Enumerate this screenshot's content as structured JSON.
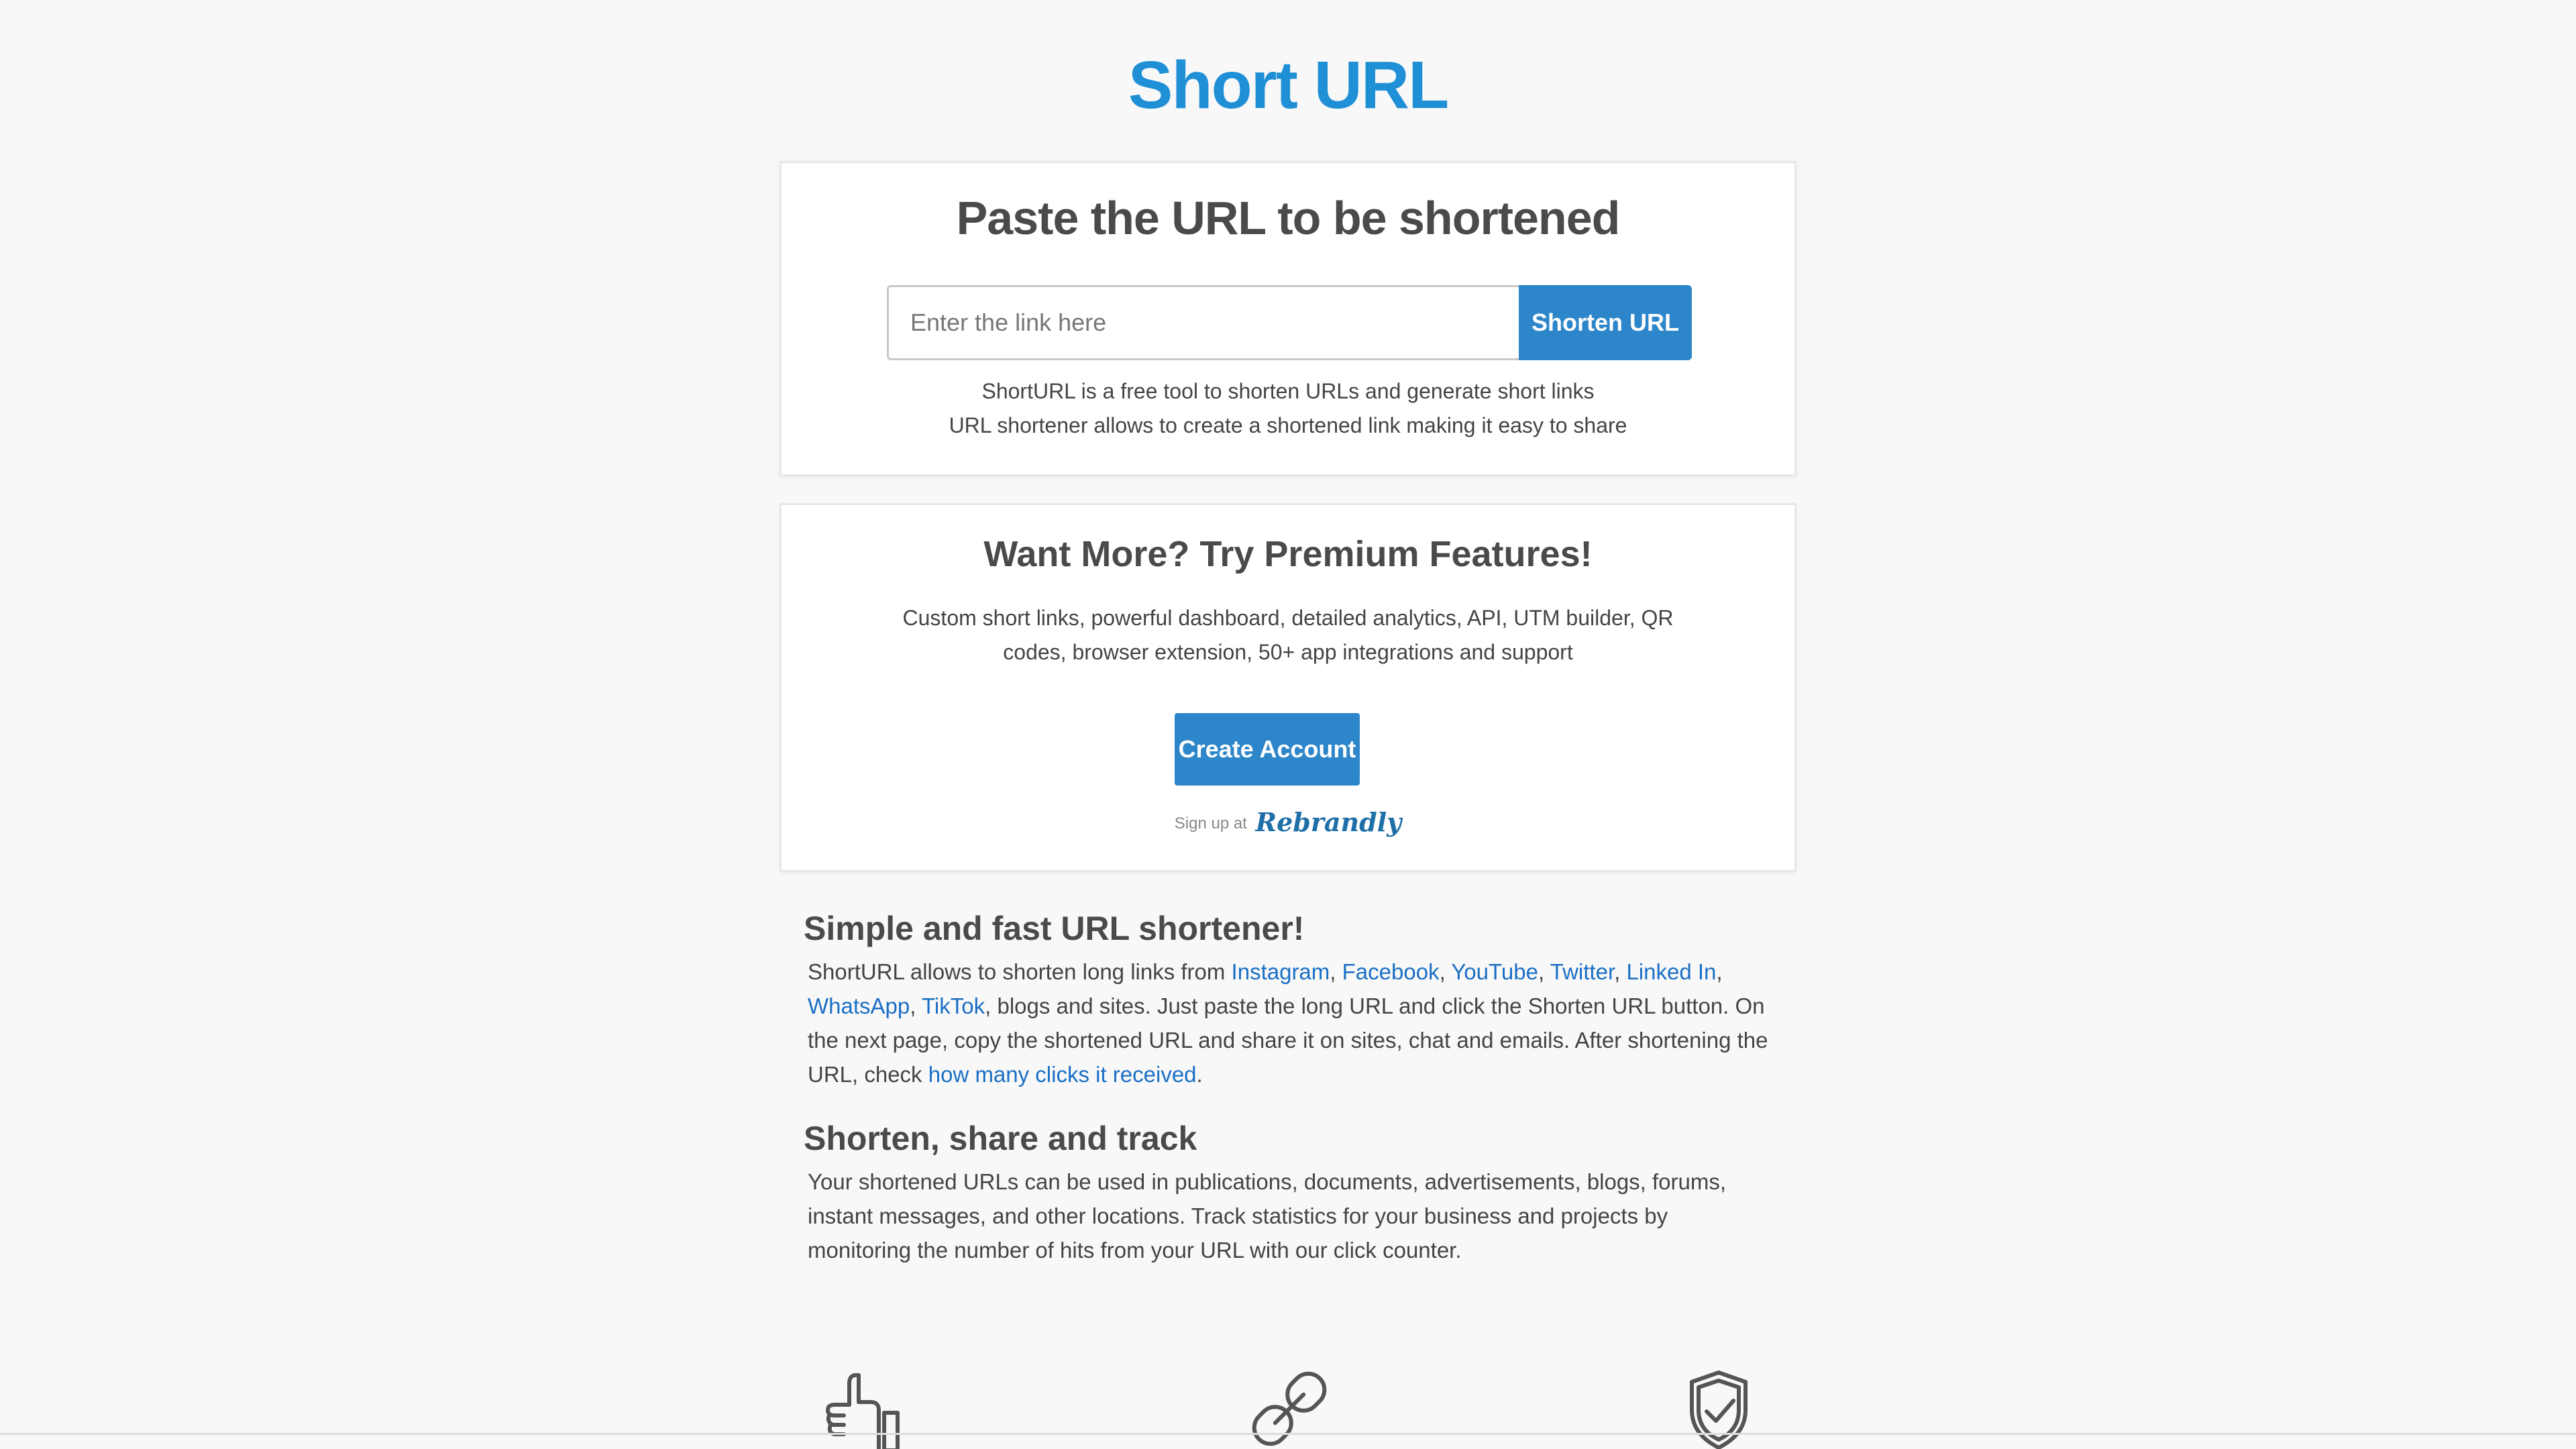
{
  "header": {
    "title": "Short URL"
  },
  "shortener": {
    "heading": "Paste the URL to be shortened",
    "input_placeholder": "Enter the link here",
    "input_value": "",
    "button_label": "Shorten URL",
    "desc_line1": "ShortURL is a free tool to shorten URLs and generate short links",
    "desc_line2": "URL shortener allows to create a shortened link making it easy to share"
  },
  "premium": {
    "heading": "Want More? Try Premium Features!",
    "description": "Custom short links, powerful dashboard, detailed analytics, API, UTM builder, QR codes, browser extension, 50+ app integrations and support",
    "button_label": "Create Account",
    "signup_prefix": "Sign up at",
    "brand": "Rebrandly"
  },
  "section_simple": {
    "heading": "Simple and fast URL shortener!",
    "text_intro": "ShortURL allows to shorten long links from ",
    "links": {
      "instagram": "Instagram",
      "facebook": "Facebook",
      "youtube": "YouTube",
      "twitter": "Twitter",
      "linkedin": "Linked In",
      "whatsapp": "WhatsApp",
      "tiktok": "TikTok",
      "clicks": "how many clicks it received"
    },
    "sep": ", ",
    "text_middle": ", blogs and sites. Just paste the long URL and click the Shorten URL button. On the next page, copy the shortened URL and share it on sites, chat and emails. After shortening the URL, check ",
    "text_end": "."
  },
  "section_share": {
    "heading": "Shorten, share and track",
    "text": "Your shortened URLs can be used in publications, documents, advertisements, blogs, forums, instant messages, and other locations. Track statistics for your business and projects by monitoring the number of hits from your URL with our click counter."
  },
  "icons": {
    "feature1": "thumbs-up-icon",
    "feature2": "chain-link-icon",
    "feature3": "shield-check-icon"
  },
  "colors": {
    "brand_blue": "#1f8fd6",
    "button_blue": "#2d86c9",
    "link_blue": "#1a6fc4",
    "background": "#f8f8f8"
  }
}
